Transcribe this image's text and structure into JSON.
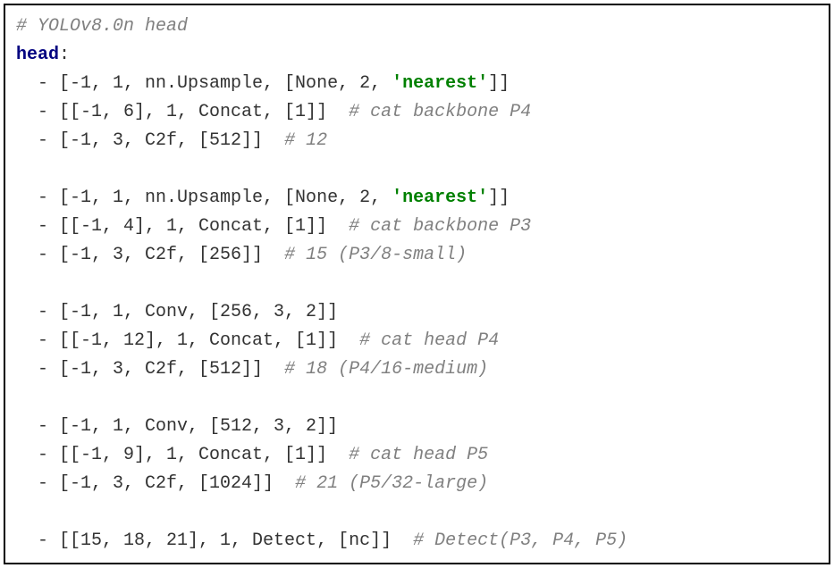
{
  "code": {
    "line1_comment": "# YOLOv8.0n head",
    "line2_key": "head",
    "line2_colon": ":",
    "line3_dash": "  - ",
    "line3_code": "[-1, 1, nn.Upsample, [None, 2, ",
    "line3_string": "'nearest'",
    "line3_end": "]]",
    "line4_dash": "  - ",
    "line4_code": "[[-1, 6], 1, Concat, [1]]  ",
    "line4_comment": "# cat backbone P4",
    "line5_dash": "  - ",
    "line5_code": "[-1, 3, C2f, [512]]  ",
    "line5_comment": "# 12",
    "line7_dash": "  - ",
    "line7_code": "[-1, 1, nn.Upsample, [None, 2, ",
    "line7_string": "'nearest'",
    "line7_end": "]]",
    "line8_dash": "  - ",
    "line8_code": "[[-1, 4], 1, Concat, [1]]  ",
    "line8_comment": "# cat backbone P3",
    "line9_dash": "  - ",
    "line9_code": "[-1, 3, C2f, [256]]  ",
    "line9_comment": "# 15 (P3/8-small)",
    "line11_dash": "  - ",
    "line11_code": "[-1, 1, Conv, [256, 3, 2]]",
    "line12_dash": "  - ",
    "line12_code": "[[-1, 12], 1, Concat, [1]]  ",
    "line12_comment": "# cat head P4",
    "line13_dash": "  - ",
    "line13_code": "[-1, 3, C2f, [512]]  ",
    "line13_comment": "# 18 (P4/16-medium)",
    "line15_dash": "  - ",
    "line15_code": "[-1, 1, Conv, [512, 3, 2]]",
    "line16_dash": "  - ",
    "line16_code": "[[-1, 9], 1, Concat, [1]]  ",
    "line16_comment": "# cat head P5",
    "line17_dash": "  - ",
    "line17_code": "[-1, 3, C2f, [1024]]  ",
    "line17_comment": "# 21 (P5/32-large)",
    "line19_dash": "  - ",
    "line19_code": "[[15, 18, 21], 1, Detect, [nc]]  ",
    "line19_comment": "# Detect(P3, P4, P5)"
  }
}
